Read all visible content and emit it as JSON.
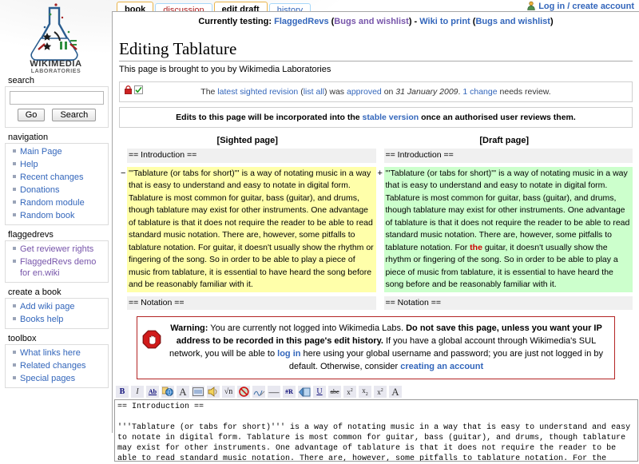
{
  "site": {
    "logo_text_main": "WIKIMEDIA",
    "logo_text_sub": "LABORATORIES"
  },
  "personal": {
    "login_label": "Log in / create account",
    "user_icon": "user-icon"
  },
  "tabs": [
    {
      "label": "book",
      "state": "selected"
    },
    {
      "label": "discussion",
      "state": "new"
    },
    {
      "label": "edit draft",
      "state": "selected"
    },
    {
      "label": "history",
      "state": "exists"
    }
  ],
  "sitenotice": {
    "prefix": "Currently testing: ",
    "link1": "FlaggedRevs",
    "paren1_open": " (",
    "link2": "Bugs and wishlist",
    "paren1_close": ") - ",
    "link3": "Wiki to print",
    "paren2_open": " (",
    "link4": "Bugs and wishlist",
    "paren2_close": ")"
  },
  "page": {
    "title": "Editing Tablature",
    "tagline": "This page is brought to you by Wikimedia Laboratories"
  },
  "search": {
    "heading": "search",
    "value": "",
    "go_label": "Go",
    "search_label": "Search"
  },
  "sidebar": {
    "portlets": [
      {
        "heading": "navigation",
        "items": [
          {
            "label": "Main Page",
            "visited": false
          },
          {
            "label": "Help",
            "visited": false
          },
          {
            "label": "Recent changes",
            "visited": false
          },
          {
            "label": "Donations",
            "visited": false
          },
          {
            "label": "Random module",
            "visited": false
          },
          {
            "label": "Random book",
            "visited": false
          }
        ]
      },
      {
        "heading": "flaggedrevs",
        "items": [
          {
            "label": "Get reviewer rights",
            "visited": true
          },
          {
            "label": "FlaggedRevs demo for en.wiki",
            "visited": true
          }
        ]
      },
      {
        "heading": "create a book",
        "items": [
          {
            "label": "Add wiki page",
            "visited": false
          },
          {
            "label": "Books help",
            "visited": false
          }
        ]
      },
      {
        "heading": "toolbox",
        "items": [
          {
            "label": "What links here",
            "visited": false
          },
          {
            "label": "Related changes",
            "visited": false
          },
          {
            "label": "Special pages",
            "visited": false
          }
        ]
      }
    ]
  },
  "flagged": {
    "review_notice": {
      "lock_icon": "lock-icon",
      "check_icon": "checkmark-icon",
      "t1": "The ",
      "link_revision": "latest sighted revision",
      "t2": " (",
      "link_listall": "list all",
      "t3": ") was ",
      "link_approved": "approved",
      "t4": " on ",
      "date": "31 January 2009",
      "t5": ". ",
      "link_change": "1 change",
      "t6": " needs review."
    },
    "stable_notice": {
      "t1": "Edits to this page will be incorporated into the ",
      "link": "stable version",
      "t2": " once an authorised user reviews them."
    }
  },
  "diff": {
    "left_header": "[Sighted page]",
    "right_header": "[Draft page]",
    "rows": [
      {
        "type": "context",
        "left_marker": "",
        "right_marker": "",
        "left_text": "== Introduction ==",
        "right_text": "== Introduction =="
      },
      {
        "type": "change",
        "left_marker": "−",
        "right_marker": "+",
        "left_text": "'''Tablature (or tabs for short)''' is a way of notating music in a way that is easy to understand and easy to notate in digital form. Tablature is most common for guitar, bass (guitar), and drums, though tablature may exist for other instruments. One advantage of tablature is that it does not require the reader to be able to read standard music notation. There are, however, some pitfalls to tablature notation. For guitar, it doesn't usually show the rhythm or fingering of the song. So in order to be able to play a piece of music from tablature, it is essential to have heard the song before and be reasonably familiar with it.",
        "right_pre": "'''Tablature (or tabs for short)''' is a way of notating music in a way that is easy to understand and easy to notate in digital form. Tablature is most common for guitar, bass (guitar), and drums, though tablature may exist for other instruments. One advantage of tablature is that it does not require the reader to be able to read standard music notation. There are, however, some pitfalls to tablature notation. For ",
        "right_changed": "the",
        "right_post": " guitar, it doesn't usually show the rhythm or fingering of the song. So in order to be able to play a piece of music from tablature, it is essential to have heard the song before and be reasonably familiar with it."
      },
      {
        "type": "context",
        "left_marker": "",
        "right_marker": "",
        "left_text": "== Notation ==",
        "right_text": "== Notation =="
      }
    ]
  },
  "warning": {
    "icon": "stop-hand-icon",
    "b1": "Warning:",
    "t1": " You are currently not logged into Wikimedia Labs. ",
    "b2": "Do not save this page, unless you want your IP address to be recorded in this page's edit history.",
    "t2": " If you have a global account through Wikimedia's SUL network, you will be able to ",
    "link_login": "log in",
    "t3": " here using your global username and password; you are just not logged in by default. Otherwise, consider ",
    "link_create": "creating an account"
  },
  "toolbar": {
    "buttons": [
      {
        "name": "bold-button",
        "glyph": "B"
      },
      {
        "name": "italic-button",
        "glyph": "I"
      },
      {
        "name": "internal-link-button",
        "glyph": "Ab"
      },
      {
        "name": "external-link-button",
        "glyph": "globe"
      },
      {
        "name": "level2-headline-button",
        "glyph": "A"
      },
      {
        "name": "embedded-file-button",
        "glyph": "image"
      },
      {
        "name": "media-file-link-button",
        "glyph": "speaker"
      },
      {
        "name": "math-formula-button",
        "glyph": "√n"
      },
      {
        "name": "nowiki-button",
        "glyph": "no-wiki"
      },
      {
        "name": "signature-button",
        "glyph": "signature"
      },
      {
        "name": "horizontal-line-button",
        "glyph": "—"
      },
      {
        "name": "redirect-button",
        "glyph": "#R"
      },
      {
        "name": "gallery-button",
        "glyph": "gallery"
      },
      {
        "name": "underline-button",
        "glyph": "U"
      },
      {
        "name": "strikethrough-button",
        "glyph": "abc"
      },
      {
        "name": "superscript-button",
        "glyph": "x²"
      },
      {
        "name": "subscript-button",
        "glyph": "x₂"
      },
      {
        "name": "small-text-button",
        "glyph": "x²"
      },
      {
        "name": "special-char-button",
        "glyph": "A"
      }
    ]
  },
  "editbox": {
    "value": "== Introduction ==\n\n'''Tablature (or tabs for short)''' is a way of notating music in a way that is easy to understand and easy to notate in digital form. Tablature is most common for guitar, bass (guitar), and drums, though tablature may exist for other instruments. One advantage of tablature is that it does not require the reader to be able to read standard music notation. There are, however, some pitfalls to tablature notation. For the guitar, it doesn't usually show the rhythm or fingering of the song. So in order to be able to play a piece of music from tablature, it is essential to have heard the song before and be reasonably familiar with it."
  },
  "colors": {
    "link": "#3366bb",
    "visited_link": "#7755aa",
    "new_link": "#b02020",
    "diff_deleted_bg": "#ffffaa",
    "diff_added_bg": "#ccffcc",
    "diff_context_bg": "#f0f0f0",
    "diff_change_text": "#cc0000",
    "warning_border": "#b32424",
    "selected_tab_border": "#e9b44a"
  }
}
